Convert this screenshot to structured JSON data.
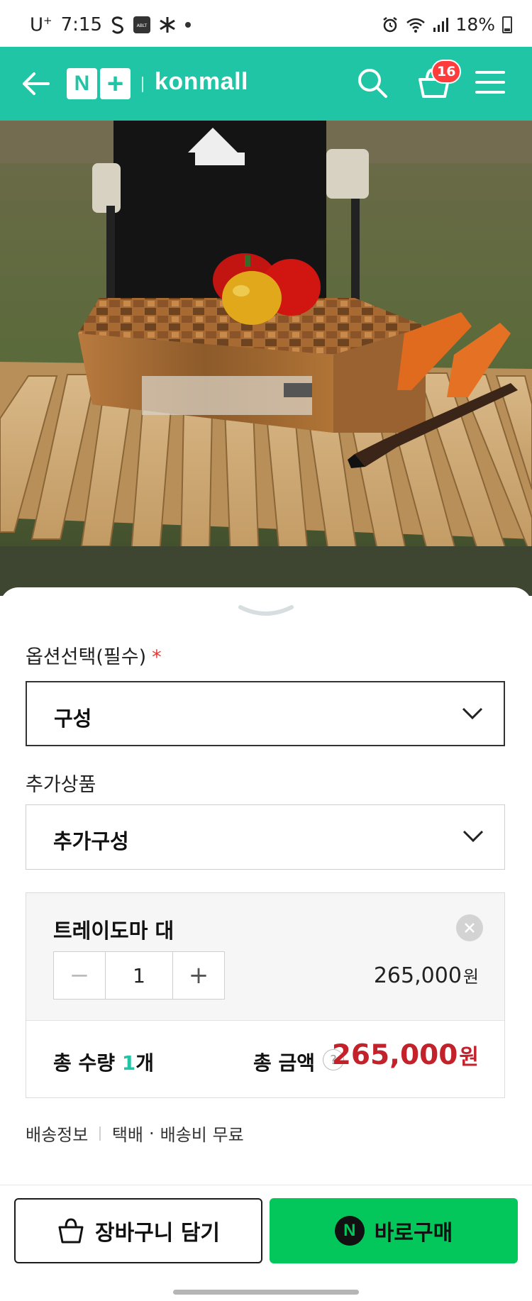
{
  "status_bar": {
    "carrier": "U",
    "carrier_sup": "+",
    "time": "7:15",
    "battery": "18%",
    "icons": [
      "s-icon",
      "ablt-app-icon",
      "asterisk-icon",
      "dot-icon",
      "alarm-icon",
      "wifi-icon",
      "signal-icon",
      "battery-icon"
    ]
  },
  "header": {
    "store_name": "konmall",
    "logo_n": "N",
    "logo_plus": "+",
    "cart_count": "16",
    "accent_color": "#20c5a5"
  },
  "options": {
    "label": "옵션선택(필수)",
    "required_mark": "*",
    "select_value": "구성"
  },
  "addon": {
    "label": "추가상품",
    "select_value": "추가구성"
  },
  "selected_item": {
    "name": "트레이도마 대",
    "quantity": "1",
    "minus": "−",
    "plus": "+",
    "price": "265,000",
    "price_unit": "원"
  },
  "totals": {
    "qty_label": "총 수량",
    "qty_value": "1",
    "qty_unit": "개",
    "amount_label": "총 금액",
    "help": "?",
    "amount": "265,000",
    "amount_unit": "원",
    "amount_color": "#c4222b"
  },
  "delivery": {
    "label": "배송정보",
    "method": "택배",
    "dot": "·",
    "fee": "배송비 무료"
  },
  "actions": {
    "cart_label": "장바구니 담기",
    "buy_label": "바로구매",
    "buy_color": "#03c75a"
  }
}
